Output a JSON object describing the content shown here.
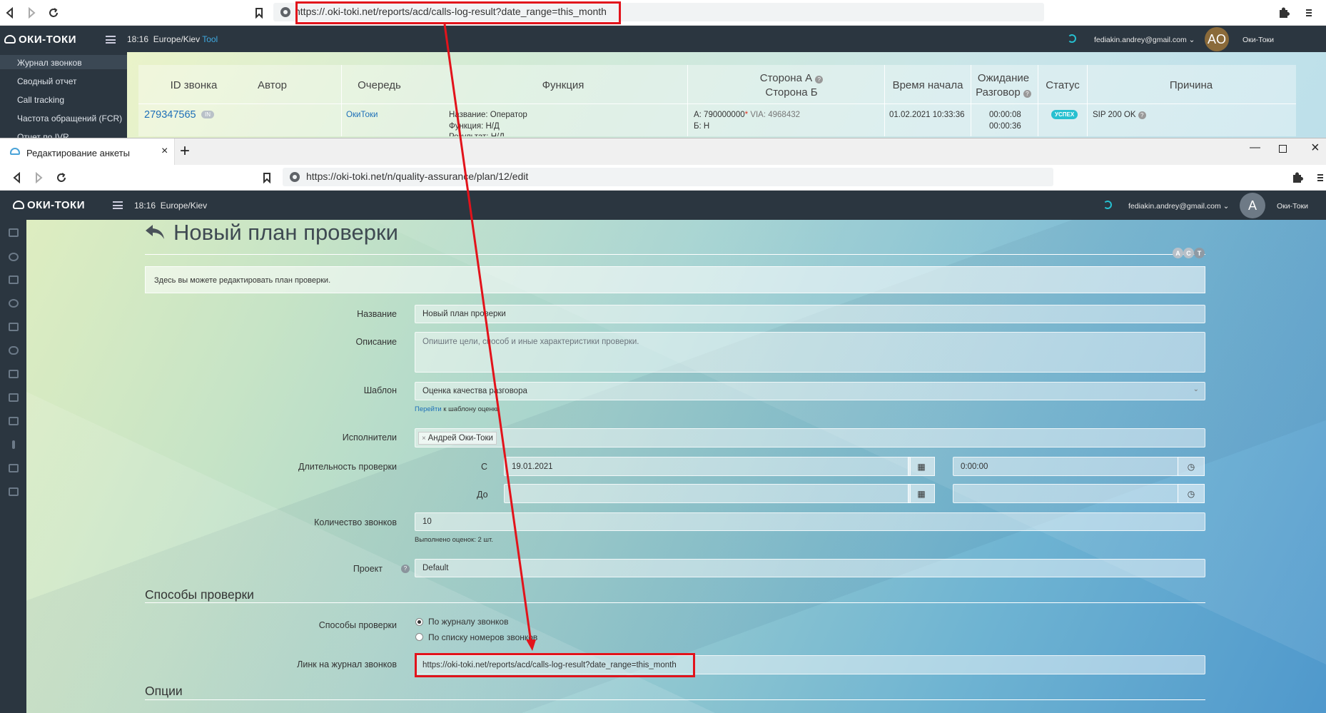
{
  "top_browser": {
    "url": "https://.oki-toki.net/reports/acd/calls-log-result?date_range=this_month"
  },
  "top_app": {
    "logo": "ОКИ-ТОКИ",
    "time": "18:16",
    "tz": "Europe/Kiev",
    "tool": "Tool",
    "email": "fediakin.andrey@gmail.com",
    "avatar": "AO",
    "company": "Оки-Токи",
    "sidebar": [
      "Журнал звонков",
      "Сводный отчет",
      "Call tracking",
      "Частота обращений (FCR)",
      "Отчет по IVR"
    ]
  },
  "calls_table": {
    "headers": {
      "id": "ID звонка",
      "author": "Автор",
      "queue": "Очередь",
      "function": "Функция",
      "side_a": "Сторона А",
      "side_b": "Сторона Б",
      "start": "Время начала",
      "wait": "Ожидание",
      "talk": "Разговор",
      "status": "Статус",
      "reason": "Причина"
    },
    "row": {
      "id": "279347565",
      "dir": "IN",
      "queue": "ОкиТоки",
      "func1": "Название: Оператор",
      "func2": "Функция: Н/Д",
      "func3": "Результат: Н/Д",
      "a_num": "А: 790000000",
      "a_mark": "*",
      "a_via": "VIA: 4968432",
      "b": "Б: Н",
      "start": "01.02.2021 10:33:36",
      "wait": "00:00:08",
      "talk": "00:00:36",
      "status": "УСПЕХ",
      "reason": "SIP 200 OK"
    }
  },
  "bottom_browser": {
    "tab_title": "Редактирование анкеты",
    "url": "https://oki-toki.net/n/quality-assurance/plan/12/edit"
  },
  "bottom_app": {
    "logo": "ОКИ-ТОКИ",
    "time": "18:16",
    "tz": "Europe/Kiev",
    "email": "fediakin.andrey@gmail.com",
    "avatar": "A",
    "company": "Оки-Токи"
  },
  "form": {
    "title": "Новый план проверки",
    "act": [
      "A",
      "C",
      "T"
    ],
    "info": "Здесь вы можете редактировать план проверки.",
    "name_label": "Название",
    "name_value": "Новый план проверки",
    "desc_label": "Описание",
    "desc_placeholder": "Опишите цели, способ и иные характеристики проверки.",
    "template_label": "Шаблон",
    "template_value": "Оценка качества разговора",
    "template_link": "Перейти",
    "template_hint": " к шаблону оценки",
    "executors_label": "Исполнители",
    "executor": "Андрей Оки-Токи",
    "duration_label": "Длительность проверки",
    "from_label": "С",
    "from_date": "19.01.2021",
    "from_time": "0:00:00",
    "to_label": "До",
    "count_label": "Количество звонков",
    "count_value": "10",
    "count_hint": "Выполнено оценок: 2 шт.",
    "project_label": "Проект",
    "project_value": "Default",
    "methods_section": "Способы проверки",
    "methods_label": "Способы проверки",
    "method1": "По журналу звонков",
    "method2": "По списку номеров звонков",
    "link_label": "Линк на журнал звонков",
    "link_value": "https://oki-toki.net/reports/acd/calls-log-result?date_range=this_month",
    "options_section": "Опции"
  },
  "colors": {
    "annotation": "#e2131b",
    "header_bg": "#2b3640",
    "accent": "#26c0d0",
    "link": "#1d6fb8"
  }
}
